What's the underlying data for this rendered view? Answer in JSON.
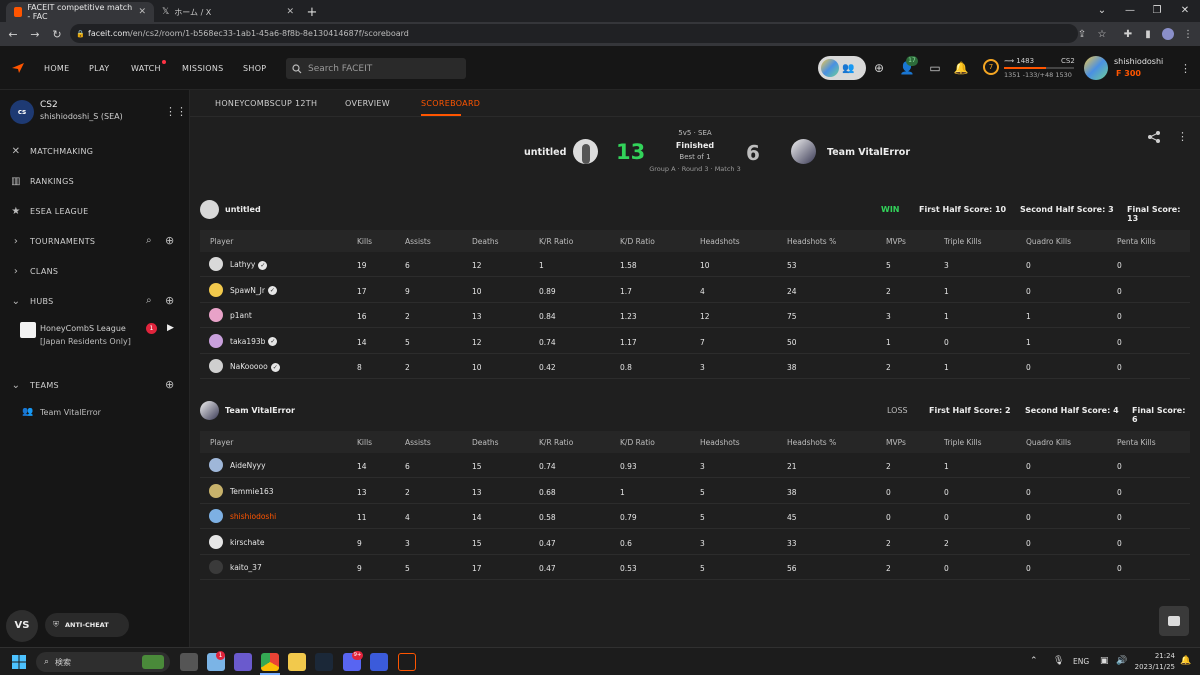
{
  "browser": {
    "tabs": [
      {
        "title": "FACEIT competitive match - FAC",
        "active": true
      },
      {
        "title": "ホーム / X",
        "active": false
      }
    ],
    "url_domain": "faceit.com",
    "url_path": "/en/cs2/room/1-b568ec33-1ab1-45a6-8f8b-8e130414687f/scoreboard"
  },
  "header": {
    "nav": [
      "HOME",
      "PLAY",
      "WATCH",
      "MISSIONS",
      "SHOP"
    ],
    "search_placeholder": "Search FACEIT",
    "friends_count": "17",
    "elo": "1483",
    "elo_range": "1351 -133/+48 1530",
    "level": "7",
    "game": "CS2",
    "username": "shishiodoshi",
    "points": "300"
  },
  "sidebar": {
    "game": "CS2",
    "account": "shishiodoshi_S (SEA)",
    "items": [
      "MATCHMAKING",
      "RANKINGS",
      "ESEA LEAGUE",
      "TOURNAMENTS",
      "CLANS",
      "HUBS",
      "TEAMS"
    ],
    "hub_name_1": "HoneyCombS League",
    "hub_name_2": "[Japan Residents Only]",
    "hub_badge": "1",
    "team": "Team VitalError",
    "vs_label": "VS",
    "anticheat": "ANTI-CHEAT"
  },
  "subnav": [
    "HONEYCOMBSCUP 12TH",
    "OVERVIEW",
    "SCOREBOARD"
  ],
  "match": {
    "team1": "untitled",
    "score1": "13",
    "team2": "Team VitalError",
    "score2": "6",
    "mode": "5v5 · SEA",
    "status": "Finished",
    "bestof": "Best of 1",
    "group": "Group A · Round 3 · Match 3"
  },
  "columns": [
    "Player",
    "Kills",
    "Assists",
    "Deaths",
    "K/R Ratio",
    "K/D Ratio",
    "Headshots",
    "Headshots %",
    "MVPs",
    "Triple Kills",
    "Quadro Kills",
    "Penta Kills"
  ],
  "teams": [
    {
      "name": "untitled",
      "result": "WIN",
      "first_half": "First Half Score: 10",
      "second_half": "Second Half Score: 3",
      "final": "Final Score: 13",
      "players": [
        {
          "name": "Lathyy",
          "verified": true,
          "stats": [
            "19",
            "6",
            "12",
            "1",
            "1.58",
            "10",
            "53",
            "5",
            "3",
            "0",
            "0"
          ]
        },
        {
          "name": "SpawN_Jr",
          "verified": true,
          "stats": [
            "17",
            "9",
            "10",
            "0.89",
            "1.7",
            "4",
            "24",
            "2",
            "1",
            "0",
            "0"
          ]
        },
        {
          "name": "p1ant",
          "verified": false,
          "stats": [
            "16",
            "2",
            "13",
            "0.84",
            "1.23",
            "12",
            "75",
            "3",
            "1",
            "1",
            "0"
          ]
        },
        {
          "name": "taka193b",
          "verified": true,
          "stats": [
            "14",
            "5",
            "12",
            "0.74",
            "1.17",
            "7",
            "50",
            "1",
            "0",
            "1",
            "0"
          ]
        },
        {
          "name": "NaKooooo",
          "verified": true,
          "stats": [
            "8",
            "2",
            "10",
            "0.42",
            "0.8",
            "3",
            "38",
            "2",
            "1",
            "0",
            "0"
          ]
        }
      ]
    },
    {
      "name": "Team VitalError",
      "result": "LOSS",
      "first_half": "First Half Score: 2",
      "second_half": "Second Half Score: 4",
      "final": "Final Score: 6",
      "players": [
        {
          "name": "AideNyyy",
          "verified": false,
          "stats": [
            "14",
            "6",
            "15",
            "0.74",
            "0.93",
            "3",
            "21",
            "2",
            "1",
            "0",
            "0"
          ]
        },
        {
          "name": "Temmie163",
          "verified": false,
          "stats": [
            "13",
            "2",
            "13",
            "0.68",
            "1",
            "5",
            "38",
            "0",
            "0",
            "0",
            "0"
          ]
        },
        {
          "name": "shishiodoshi",
          "verified": false,
          "highlight": true,
          "stats": [
            "11",
            "4",
            "14",
            "0.58",
            "0.79",
            "5",
            "45",
            "0",
            "0",
            "0",
            "0"
          ]
        },
        {
          "name": "kirschate",
          "verified": false,
          "stats": [
            "9",
            "3",
            "15",
            "0.47",
            "0.6",
            "3",
            "33",
            "2",
            "2",
            "0",
            "0"
          ]
        },
        {
          "name": "kaito_37",
          "verified": false,
          "stats": [
            "9",
            "5",
            "17",
            "0.47",
            "0.53",
            "5",
            "56",
            "2",
            "0",
            "0",
            "0"
          ]
        }
      ]
    }
  ],
  "taskbar": {
    "search": "検索",
    "lang": "ENG",
    "time": "21:24",
    "date": "2023/11/25",
    "weather_badge": "1",
    "discord_badge": "9+"
  },
  "colors": {
    "accent": "#ff5500",
    "win": "#32d35a",
    "background": "#1f1f1f",
    "sidebar": "#161616"
  }
}
